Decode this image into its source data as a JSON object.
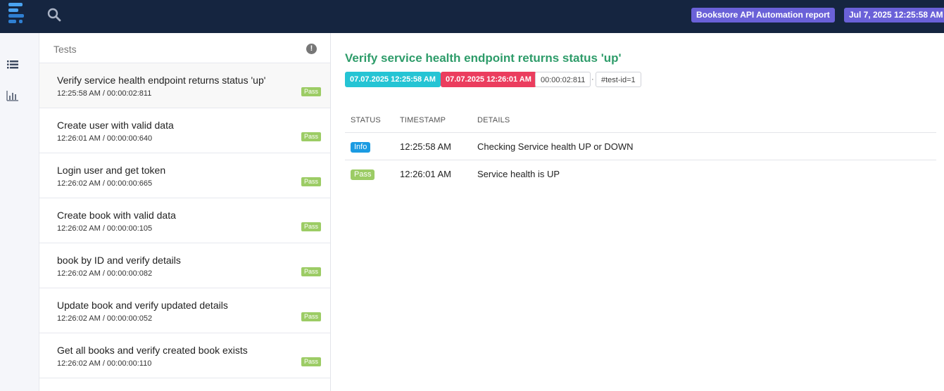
{
  "header": {
    "report_name": "Bookstore API Automation report",
    "report_date": "Jul 7, 2025 12:25:58 AM",
    "logo_icon": "extent-logo-icon",
    "search_icon": "search-icon"
  },
  "nav": {
    "items": [
      {
        "icon": "list-icon"
      },
      {
        "icon": "bar-chart-icon"
      }
    ]
  },
  "tests": {
    "title": "Tests",
    "items": [
      {
        "name": "Verify service health endpoint returns status 'up'",
        "meta": "12:25:58 AM / 00:00:02:811",
        "status": "Pass"
      },
      {
        "name": "Create user with valid data",
        "meta": "12:26:01 AM / 00:00:00:640",
        "status": "Pass"
      },
      {
        "name": "Login user and get token",
        "meta": "12:26:02 AM / 00:00:00:665",
        "status": "Pass"
      },
      {
        "name": "Create book with valid data",
        "meta": "12:26:02 AM / 00:00:00:105",
        "status": "Pass"
      },
      {
        "name": "book by ID and verify details",
        "meta": "12:26:02 AM / 00:00:00:082",
        "status": "Pass"
      },
      {
        "name": "Update book and verify updated details",
        "meta": "12:26:02 AM / 00:00:00:052",
        "status": "Pass"
      },
      {
        "name": "Get all books and verify created book exists",
        "meta": "12:26:02 AM / 00:00:00:110",
        "status": "Pass"
      }
    ]
  },
  "detail": {
    "title": "Verify service health endpoint returns status 'up'",
    "start": "07.07.2025 12:25:58 AM",
    "end": "07.07.2025 12:26:01 AM",
    "duration": "00:00:02:811",
    "separator": "·",
    "test_id": "#test-id=1",
    "columns": {
      "status": "STATUS",
      "timestamp": "TIMESTAMP",
      "details": "DETAILS"
    },
    "logs": [
      {
        "status": "Info",
        "timestamp": "12:25:58 AM",
        "details": "Checking Service health UP or DOWN"
      },
      {
        "status": "Pass",
        "timestamp": "12:26:01 AM",
        "details": "Service health is UP"
      }
    ]
  },
  "colors": {
    "topbar": "#152540",
    "accent": "#6a61d8",
    "title_green": "#2e9c6a",
    "start_chip": "#25c4d4",
    "end_chip": "#eb3d5e",
    "pass": "#9ccc65",
    "info": "#1b9be2"
  }
}
